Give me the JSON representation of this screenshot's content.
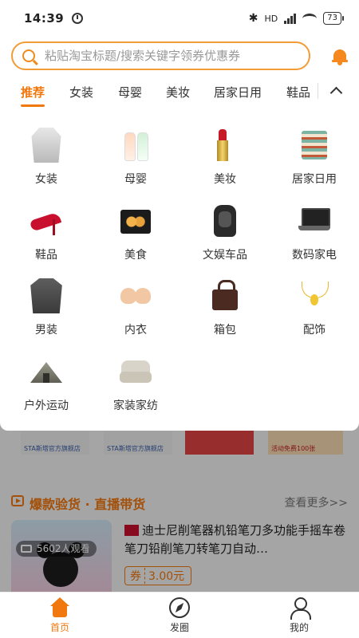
{
  "status_bar": {
    "time": "14:39",
    "battery": "73",
    "network_label": "HD"
  },
  "search": {
    "placeholder": "粘贴淘宝标题/搜索关键字领券优惠券"
  },
  "tabs": [
    {
      "label": "推荐",
      "active": true
    },
    {
      "label": "女装",
      "active": false
    },
    {
      "label": "母婴",
      "active": false
    },
    {
      "label": "美妆",
      "active": false
    },
    {
      "label": "居家日用",
      "active": false
    },
    {
      "label": "鞋品",
      "active": false
    }
  ],
  "categories": [
    {
      "label": "女装",
      "icon": "coat-icon"
    },
    {
      "label": "母婴",
      "icon": "baby-bottle-icon"
    },
    {
      "label": "美妆",
      "icon": "lipstick-icon"
    },
    {
      "label": "居家日用",
      "icon": "bowls-icon"
    },
    {
      "label": "鞋品",
      "icon": "high-heel-icon"
    },
    {
      "label": "美食",
      "icon": "food-box-icon"
    },
    {
      "label": "文娱车品",
      "icon": "car-seat-icon"
    },
    {
      "label": "数码家电",
      "icon": "laptop-icon"
    },
    {
      "label": "男装",
      "icon": "jacket-icon"
    },
    {
      "label": "内衣",
      "icon": "bra-icon"
    },
    {
      "label": "箱包",
      "icon": "handbag-icon"
    },
    {
      "label": "配饰",
      "icon": "necklace-icon"
    },
    {
      "label": "户外运动",
      "icon": "tent-icon"
    },
    {
      "label": "家装家纺",
      "icon": "sofa-icon"
    }
  ],
  "banners": {
    "b1": "STA斯塔官方旗舰店",
    "b2": "STA斯塔官方旗舰店",
    "b4": "活动免费100张"
  },
  "section": {
    "title": "爆款验货 · 直播带货",
    "more": "查看更多>>"
  },
  "live_card": {
    "viewers": "5602人观看",
    "title": "迪士尼削笔器机铅笔刀多功能手摇车卷笔刀铅削笔刀转笔刀自动…",
    "coupon_tag": "券",
    "coupon_amount": "3.00元"
  },
  "bottom_nav": [
    {
      "label": "首页",
      "active": true
    },
    {
      "label": "发圈",
      "active": false
    },
    {
      "label": "我的",
      "active": false
    }
  ],
  "colors": {
    "accent": "#f0780f",
    "search_border": "#f29c38"
  }
}
